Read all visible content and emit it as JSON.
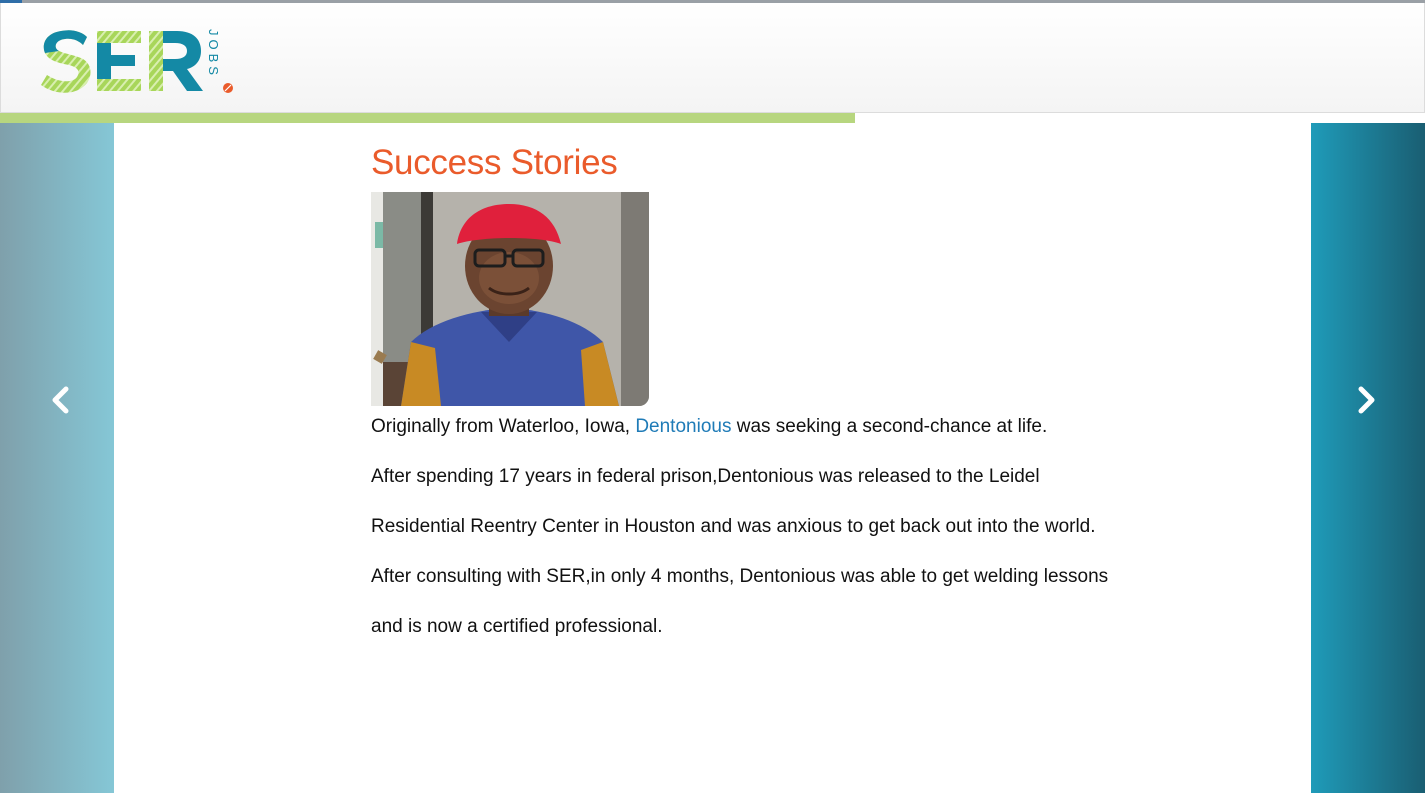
{
  "brand": {
    "logo_text": "SER",
    "logo_subtext": "JOBS",
    "colors": {
      "teal": "#1489a5",
      "green": "#8cc63f",
      "orange": "#ea5b2b",
      "link": "#1f7bb7"
    }
  },
  "progress": {
    "fraction": 0.6
  },
  "carousel": {
    "prev_icon": "chevron-left-icon",
    "next_icon": "chevron-right-icon"
  },
  "page": {
    "title": "Success Stories",
    "story": {
      "intro_before": "Originally from Waterloo, Iowa, ",
      "name_link": "Dentonious",
      "intro_after": " was seeking a second-chance at life.",
      "lines": [
        "After spending 17 years in federal prison,Dentonious was released to the Leidel",
        "Residential Reentry Center in Houston and was anxious to get back out into the world.",
        "After consulting with SER,in only 4 months, Dentonious was able to get welding lessons",
        "and is now a certified professional."
      ]
    }
  }
}
